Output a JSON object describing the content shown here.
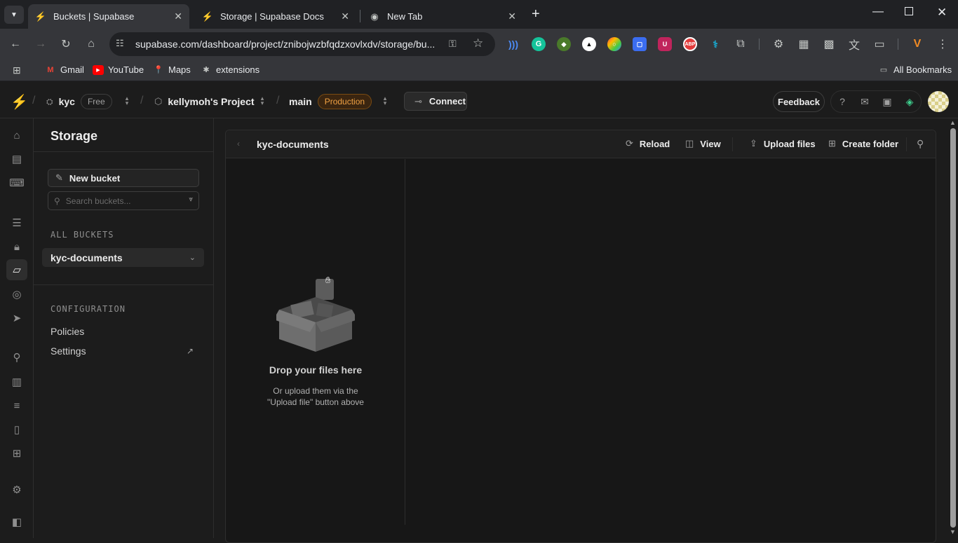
{
  "browser": {
    "tabs": [
      {
        "title": "Buckets | Supabase",
        "active": true
      },
      {
        "title": "Storage | Supabase Docs",
        "active": false
      },
      {
        "title": "New Tab",
        "active": false
      }
    ],
    "url": "supabase.com/dashboard/project/znibojwzbfqdzxovlxdv/storage/bu...",
    "bookmarks": [
      "Gmail",
      "YouTube",
      "Maps",
      "extensions"
    ],
    "all_bookmarks": "All Bookmarks",
    "extensions": {
      "abp_label": "ABP",
      "ublock_label": "U"
    }
  },
  "header": {
    "org": "kyc",
    "org_plan": "Free",
    "project": "kellymoh's Project",
    "branch": "main",
    "branch_badge": "Production",
    "connect_label": "Connect",
    "feedback_label": "Feedback"
  },
  "sidebar": {
    "title": "Storage",
    "new_bucket_label": "New bucket",
    "search_placeholder": "Search buckets...",
    "all_buckets_label": "ALL BUCKETS",
    "buckets": [
      {
        "name": "kyc-documents"
      }
    ],
    "configuration_label": "CONFIGURATION",
    "config_links": [
      "Policies",
      "Settings"
    ]
  },
  "explorer": {
    "bucket_name": "kyc-documents",
    "reload_label": "Reload",
    "view_label": "View",
    "upload_label": "Upload files",
    "create_folder_label": "Create folder",
    "drop_title": "Drop your files here",
    "drop_sub_line1": "Or upload them via the",
    "drop_sub_line2": "\"Upload file\" button above"
  },
  "colors": {
    "accent_green": "#3ecf8e",
    "production_orange": "#f0a143",
    "background": "#1c1c1c"
  }
}
